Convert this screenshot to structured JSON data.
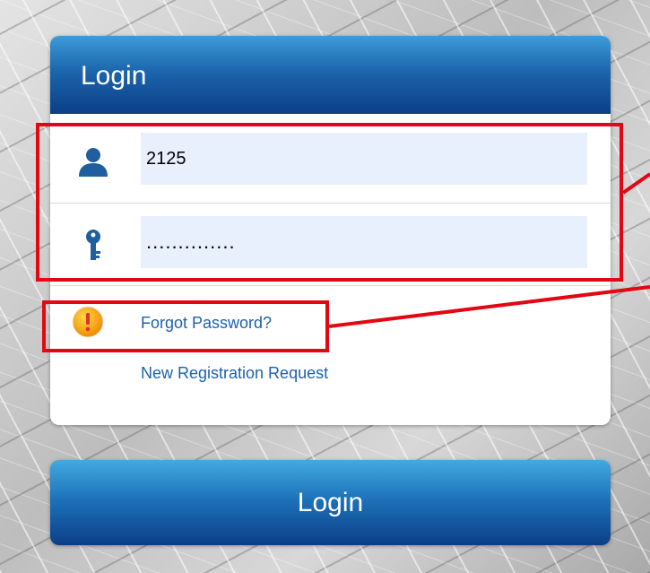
{
  "login_panel": {
    "title": "Login",
    "username": {
      "value": "2125",
      "icon": "user-icon"
    },
    "password": {
      "value": "..............",
      "icon": "key-icon"
    },
    "forgot_password": {
      "label": "Forgot Password?",
      "icon": "warning-icon"
    },
    "new_registration": {
      "label": "New Registration Request"
    }
  },
  "login_button": {
    "label": "Login"
  },
  "colors": {
    "header_blue": "#0b3f86",
    "link_blue": "#1d61ad",
    "icon_blue": "#1f5f9e",
    "input_bg": "#e8f0fd",
    "annotation_red": "#e30613",
    "warning_orange": "#f7a600"
  }
}
